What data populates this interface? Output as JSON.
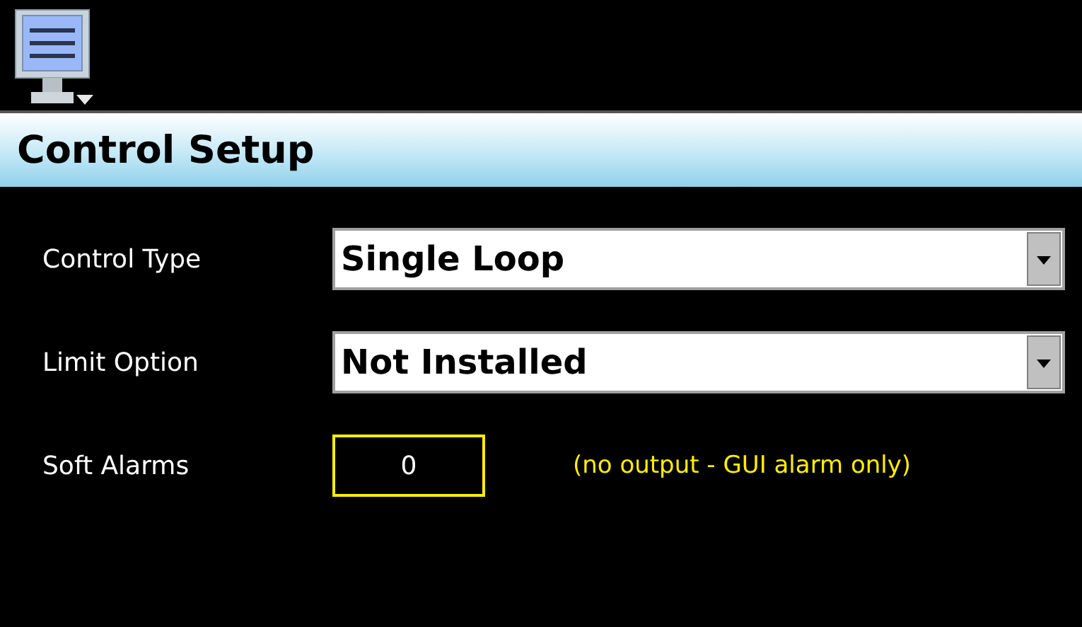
{
  "header": {
    "title": "Control Setup"
  },
  "settings": [
    {
      "kind": "dropdown",
      "label": "Control Type",
      "value": "Single Loop"
    },
    {
      "kind": "dropdown",
      "label": "Limit Option",
      "value": "Not Installed"
    },
    {
      "kind": "field",
      "label": "Soft Alarms",
      "value": "0",
      "note": "(no output - GUI alarm only)"
    }
  ]
}
